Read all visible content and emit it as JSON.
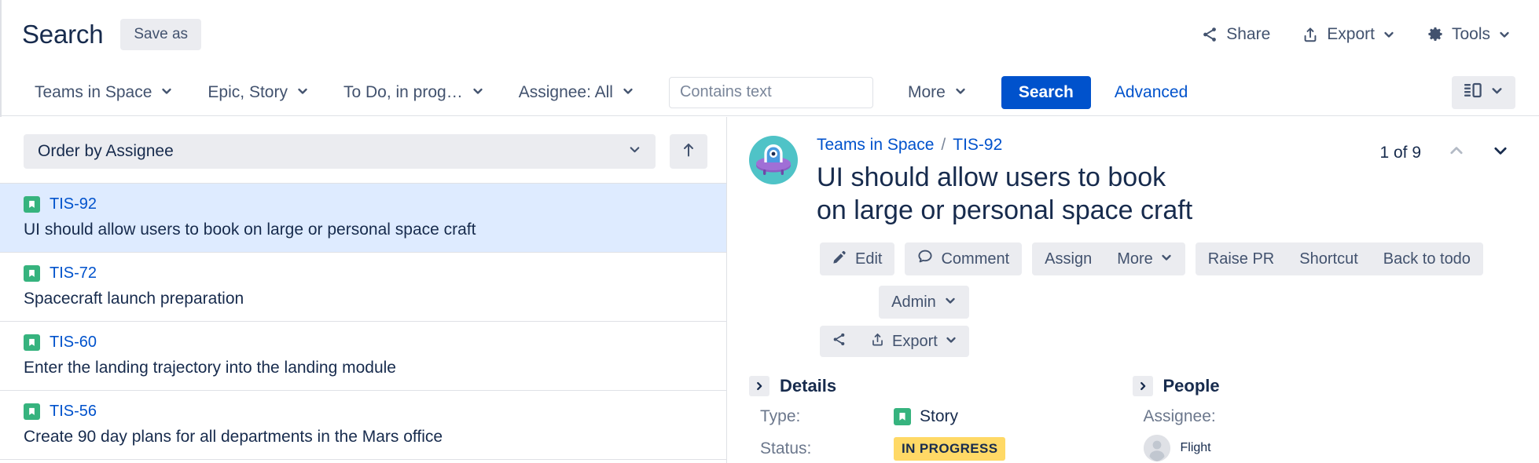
{
  "header": {
    "title": "Search",
    "save_as_label": "Save as",
    "actions": [
      {
        "label": "Share",
        "icon": "share-icon",
        "has_chevron": false
      },
      {
        "label": "Export",
        "icon": "export-icon",
        "has_chevron": true
      },
      {
        "label": "Tools",
        "icon": "gear-icon",
        "has_chevron": true
      }
    ]
  },
  "filterbar": {
    "filters": [
      {
        "label": "Teams in Space"
      },
      {
        "label": "Epic, Story"
      },
      {
        "label": "To Do, in prog…"
      },
      {
        "label": "Assignee: All"
      }
    ],
    "contains_placeholder": "Contains text",
    "contains_value": "",
    "more_label": "More",
    "search_label": "Search",
    "advanced_label": "Advanced",
    "view_toggle_icon": "detail-view-icon"
  },
  "list": {
    "order_by_label": "Order by Assignee",
    "sort_direction_icon": "arrow-up-icon",
    "issues": [
      {
        "key": "TIS-92",
        "summary": "UI should allow users to book on large or personal space craft",
        "type_icon": "story-icon",
        "selected": true
      },
      {
        "key": "TIS-72",
        "summary": "Spacecraft launch preparation",
        "type_icon": "story-icon",
        "selected": false
      },
      {
        "key": "TIS-60",
        "summary": "Enter the landing trajectory into the landing module",
        "type_icon": "story-icon",
        "selected": false
      },
      {
        "key": "TIS-56",
        "summary": "Create 90 day plans for all departments in the Mars office",
        "type_icon": "story-icon",
        "selected": false
      }
    ]
  },
  "detail": {
    "project_avatar_icon": "ufo-avatar-icon",
    "breadcrumb_project": "Teams in Space",
    "breadcrumb_separator": "/",
    "breadcrumb_issue": "TIS-92",
    "title_line1": "UI should allow users to book",
    "title_line2": "on large or personal space craft",
    "pager_label": "1 of 9",
    "pager_prev_icon": "chevron-up-icon",
    "pager_next_icon": "chevron-down-icon",
    "actions": {
      "edit_label": "Edit",
      "comment_label": "Comment",
      "assign_label": "Assign",
      "more_label": "More",
      "raise_pr_label": "Raise PR",
      "shortcut_label": "Shortcut",
      "back_to_todo_label": "Back to todo",
      "admin_label": "Admin",
      "share_icon": "share-icon",
      "export_label": "Export"
    },
    "details_panel": {
      "heading": "Details",
      "type_label": "Type:",
      "type_value": "Story",
      "status_label": "Status:",
      "status_value": "IN PROGRESS"
    },
    "people_panel": {
      "heading": "People",
      "assignee_label": "Assignee:",
      "assignee_value": "Flight"
    }
  },
  "colors": {
    "brand_blue": "#0052CC",
    "link_blue": "#0052CC",
    "text": "#172B4D",
    "subtle_text": "#6B778C",
    "chip_bg": "#EBECF0",
    "selected_row": "#DEEBFF",
    "story_green": "#36B37E",
    "status_yellow": "#FFD966",
    "border": "#DFE1E6"
  }
}
